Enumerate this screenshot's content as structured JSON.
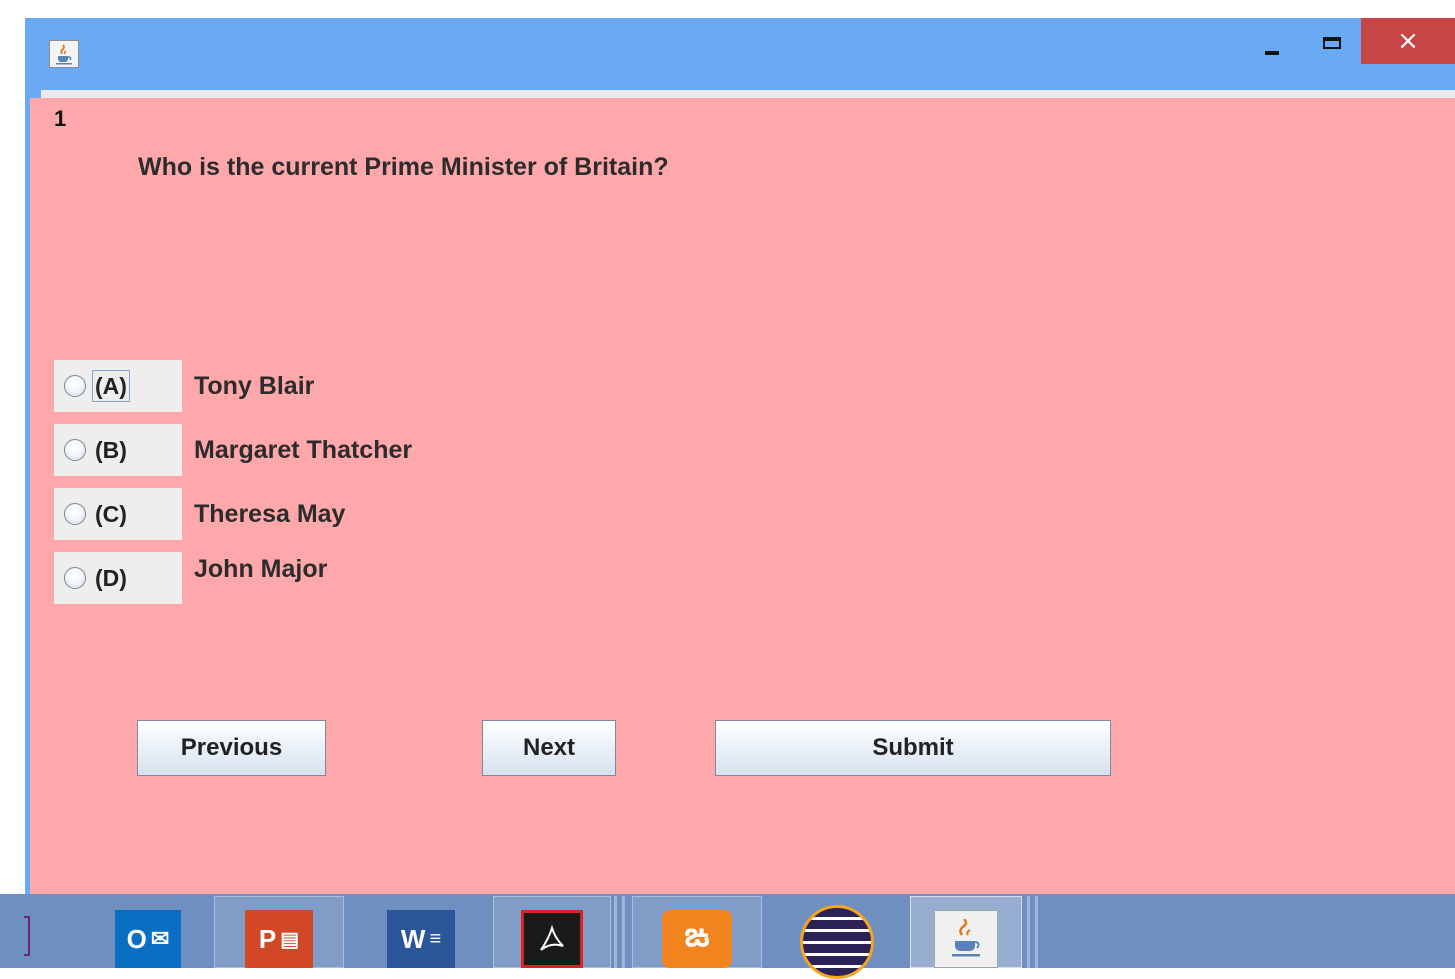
{
  "window": {
    "app_icon": "java-coffee-icon",
    "controls": {
      "minimize": "minimize-icon",
      "maximize": "maximize-icon",
      "close": "×"
    }
  },
  "quiz": {
    "question_number": "1",
    "question": "Who is the current Prime Minister of Britain?",
    "options": [
      {
        "letter": "(A)",
        "text": "Tony Blair"
      },
      {
        "letter": "(B)",
        "text": "Margaret Thatcher"
      },
      {
        "letter": "(C)",
        "text": "Theresa May"
      },
      {
        "letter": "(D)",
        "text": "John Major"
      }
    ]
  },
  "buttons": {
    "previous": "Previous",
    "next": "Next",
    "submit": "Submit"
  },
  "taskbar": {
    "apps": [
      {
        "name": "outlook-icon",
        "label": "O",
        "color": "#0a6fc2"
      },
      {
        "name": "powerpoint-icon",
        "label": "P",
        "color": "#d24726"
      },
      {
        "name": "word-icon",
        "label": "W",
        "color": "#2b579a"
      },
      {
        "name": "acrobat-icon",
        "label": "",
        "color": "#8c1111"
      },
      {
        "name": "xampp-icon",
        "label": "",
        "color": "#f2841f"
      },
      {
        "name": "eclipse-icon",
        "label": "",
        "color": "#2c2255"
      },
      {
        "name": "java-icon",
        "label": "",
        "color": "#f0f0f0"
      }
    ]
  },
  "colors": {
    "panel": "#fea8ab",
    "titlebar": "#6aa9f3",
    "close": "#c74545",
    "taskbar": "#6f8fc0"
  }
}
